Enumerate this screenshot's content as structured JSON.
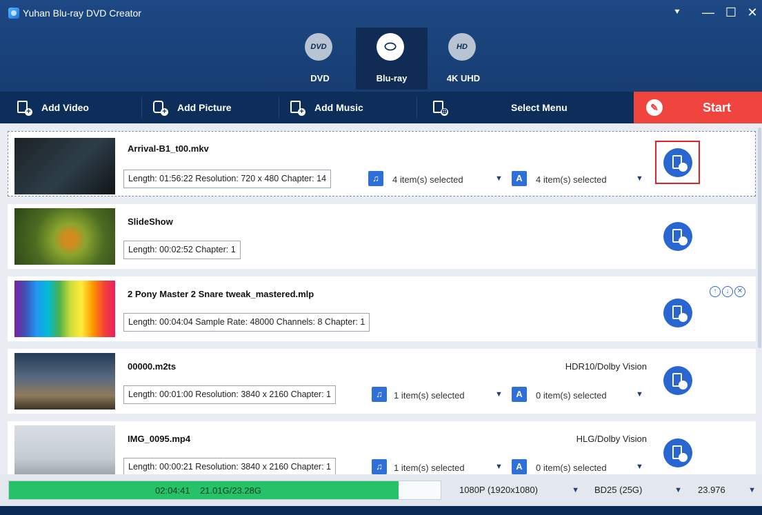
{
  "app": {
    "title": "Yuhan Blu-ray DVD Creator"
  },
  "window_controls": [
    "⯆",
    "—",
    "☐",
    "✕"
  ],
  "modes": [
    {
      "label": "DVD",
      "icon": "dvd-icon",
      "glyph": "DVD",
      "active": false
    },
    {
      "label": "Blu-ray",
      "icon": "bluray-icon",
      "glyph": "⬭",
      "active": true
    },
    {
      "label": "4K UHD",
      "icon": "4k-uhd-icon",
      "glyph": "HD",
      "active": false
    }
  ],
  "toolbar": {
    "add_video": "Add Video",
    "add_picture": "Add Picture",
    "add_music": "Add Music",
    "select_menu": "Select Menu",
    "start": "Start"
  },
  "items": [
    {
      "filename": "Arrival-B1_t00.mkv",
      "info": "Length: 01:56:22  Resolution: 720 x 480  Chapter: 14",
      "audio": "4 item(s) selected",
      "subtitle": "4 item(s) selected",
      "tag": "",
      "selected": true
    },
    {
      "filename": "SlideShow",
      "info": "Length: 00:02:52  Chapter: 1",
      "tag": ""
    },
    {
      "filename": "2 Pony Master 2 Snare tweak_mastered.mlp",
      "info": "Length: 00:04:04  Sample Rate: 48000  Channels: 8  Chapter: 1",
      "tag": ""
    },
    {
      "filename": "00000.m2ts",
      "info": "Length: 00:01:00  Resolution: 3840 x 2160  Chapter: 1",
      "audio": "1 item(s) selected",
      "subtitle": "0 item(s) selected",
      "tag": "HDR10/Dolby Vision"
    },
    {
      "filename": "IMG_0095.mp4",
      "info": "Length: 00:00:21  Resolution: 3840 x 2160  Chapter: 1",
      "audio": "1 item(s) selected",
      "subtitle": "0 item(s) selected",
      "tag": "HLG/Dolby Vision"
    }
  ],
  "row_actions": {
    "move_up": "↑",
    "move_down": "↓",
    "remove": "✕"
  },
  "status": {
    "duration": "02:04:41",
    "size": "21.01G/23.28G",
    "fill_fraction": 0.9025,
    "resolution": "1080P (1920x1080)",
    "disc": "BD25 (25G)",
    "framerate": "23.976"
  },
  "colors": {
    "header": "#1d4884",
    "toolbar": "#0d2d5a",
    "start": "#f0453f",
    "accent": "#2966d1",
    "progress": "#25c26a"
  }
}
